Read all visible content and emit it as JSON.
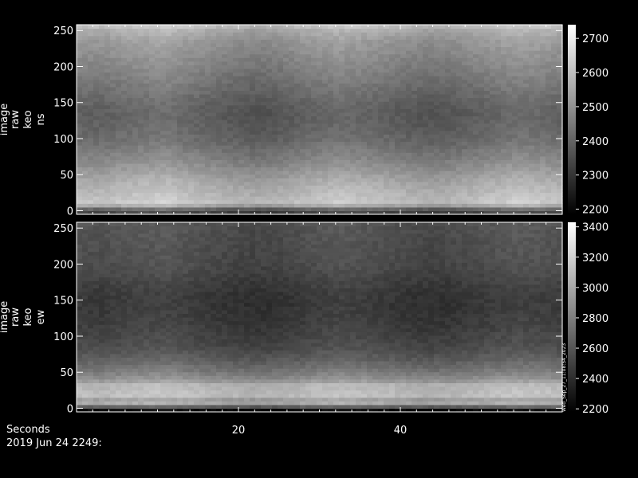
{
  "chart_data": [
    {
      "type": "heatmap",
      "panel": "top",
      "ylabel_lines": [
        "image",
        "raw",
        "keo",
        "ns"
      ],
      "x_ticks": [
        20,
        40
      ],
      "xlim": [
        0,
        60
      ],
      "y_ticks": [
        0,
        50,
        100,
        150,
        200,
        250
      ],
      "ylim": [
        -5,
        258
      ],
      "colorbar": {
        "ticks": [
          2200,
          2300,
          2400,
          2500,
          2600,
          2700
        ],
        "range": [
          2185,
          2740
        ],
        "colormap": "grayscale"
      },
      "profile_y": [
        0,
        10,
        25,
        40,
        55,
        70,
        85,
        100,
        115,
        130,
        145,
        160,
        175,
        190,
        205,
        220,
        235,
        250,
        255
      ],
      "profile_value": [
        2340,
        2620,
        2590,
        2560,
        2520,
        2480,
        2450,
        2420,
        2405,
        2395,
        2400,
        2420,
        2440,
        2460,
        2480,
        2500,
        2520,
        2560,
        2600
      ],
      "time_modulation": [
        0,
        -5,
        10,
        20,
        30,
        5,
        -10,
        -25,
        -35,
        -30,
        -10,
        5,
        15,
        5,
        -5,
        -20,
        -30,
        -25,
        -10,
        5,
        20,
        15,
        0
      ]
    },
    {
      "type": "heatmap",
      "panel": "bottom",
      "ylabel_lines": [
        "image",
        "raw",
        "keo",
        "ew"
      ],
      "x_ticks": [
        20,
        40
      ],
      "xlim": [
        0,
        60
      ],
      "y_ticks": [
        0,
        50,
        100,
        150,
        200,
        250
      ],
      "ylim": [
        -5,
        258
      ],
      "colorbar": {
        "ticks": [
          2200,
          2400,
          2600,
          2800,
          3000,
          3200,
          3400
        ],
        "range": [
          2180,
          3430
        ],
        "colormap": "grayscale"
      },
      "profile_y": [
        0,
        5,
        15,
        20,
        25,
        30,
        40,
        55,
        70,
        85,
        100,
        115,
        130,
        145,
        160,
        175,
        190,
        205,
        220,
        235,
        250,
        255
      ],
      "profile_value": [
        2250,
        3050,
        2950,
        3250,
        3000,
        3150,
        2900,
        2750,
        2640,
        2560,
        2520,
        2490,
        2470,
        2460,
        2470,
        2500,
        2540,
        2560,
        2570,
        2580,
        2590,
        2600
      ],
      "time_modulation": [
        0,
        -10,
        15,
        30,
        40,
        10,
        -20,
        -40,
        -55,
        -45,
        -20,
        10,
        30,
        10,
        -10,
        -35,
        -50,
        -40,
        -15,
        10,
        35,
        25,
        0
      ]
    }
  ],
  "footer": {
    "xaxis_label": "Seconds",
    "date_label": "2019 Jun 24 2249:"
  },
  "stamp": "Wed_Sep_27_11:08:54_2023"
}
